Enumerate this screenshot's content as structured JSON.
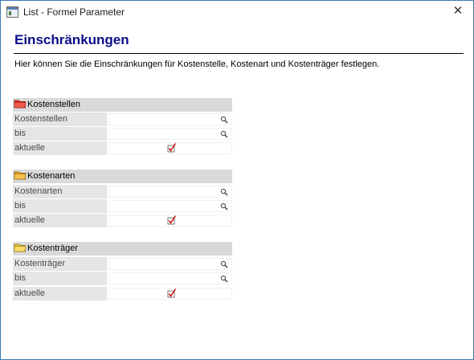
{
  "window": {
    "title": "List - Formel Parameter",
    "close_glyph": "✕"
  },
  "page": {
    "heading": "Einschränkungen",
    "intro": "Hier können Sie die Einschränkungen für Kostenstelle, Kostenart und Kostenträger festlegen."
  },
  "groups": [
    {
      "title": "Kostenstellen",
      "icon": "red-folder-icon",
      "icon_color": "#e0302a",
      "rows": [
        {
          "label": "Kostenstellen",
          "type": "lookup",
          "value": ""
        },
        {
          "label": "bis",
          "type": "lookup",
          "value": ""
        },
        {
          "label": "aktuelle",
          "type": "checkbox",
          "checked": true
        }
      ]
    },
    {
      "title": "Kostenarten",
      "icon": "orange-folder-icon",
      "icon_color": "#f0a020",
      "rows": [
        {
          "label": "Kostenarten",
          "type": "lookup",
          "value": ""
        },
        {
          "label": "bis",
          "type": "lookup",
          "value": ""
        },
        {
          "label": "aktuelle",
          "type": "checkbox",
          "checked": true
        }
      ]
    },
    {
      "title": "Kostenträger",
      "icon": "yellow-folder-icon",
      "icon_color": "#f4c430",
      "rows": [
        {
          "label": "Kostenträger",
          "type": "lookup",
          "value": ""
        },
        {
          "label": "bis",
          "type": "lookup",
          "value": ""
        },
        {
          "label": "aktuelle",
          "type": "checkbox",
          "checked": true
        }
      ]
    }
  ],
  "colors": {
    "heading": "#0c0f8a",
    "checkmark": "#d01010"
  }
}
